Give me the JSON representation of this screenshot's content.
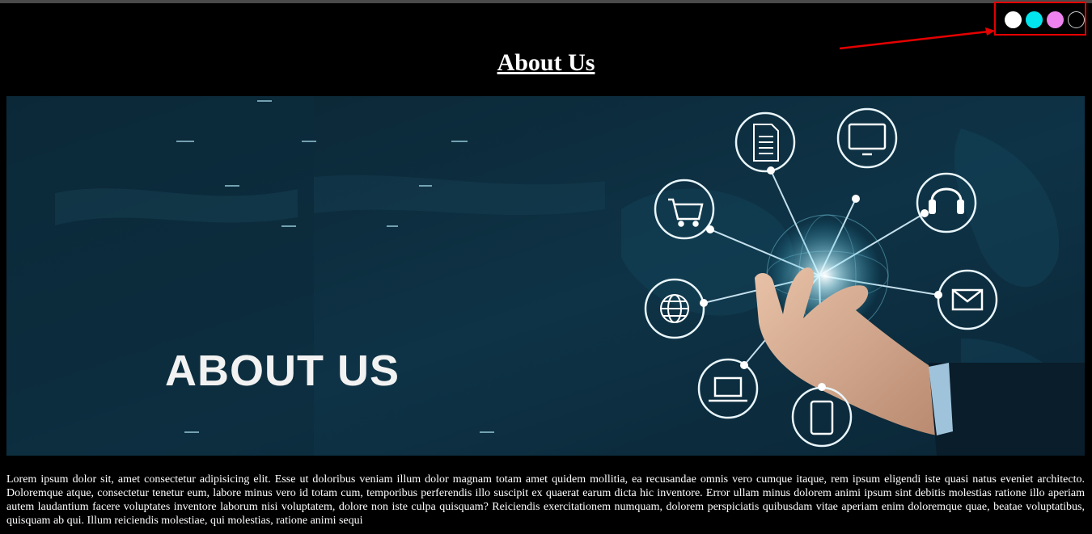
{
  "header": {
    "title": "About Us"
  },
  "theme_picker": {
    "swatches": [
      {
        "name": "white",
        "color": "#ffffff"
      },
      {
        "name": "cyan",
        "color": "#00e5ee"
      },
      {
        "name": "violet",
        "color": "#ee82ee"
      },
      {
        "name": "black",
        "color": "#000000"
      }
    ],
    "highlight_color": "#e60000"
  },
  "hero": {
    "overlay_text": "ABOUT US",
    "icons": [
      "document-icon",
      "monitor-icon",
      "headset-icon",
      "envelope-icon",
      "tablet-icon",
      "laptop-icon",
      "globe-icon",
      "shopping-cart-icon"
    ]
  },
  "content": {
    "paragraph": "Lorem ipsum dolor sit, amet consectetur adipisicing elit. Esse ut doloribus veniam illum dolor magnam totam amet quidem mollitia, ea recusandae omnis vero cumque itaque, rem ipsum eligendi iste quasi natus eveniet architecto. Doloremque atque, consectetur tenetur eum, labore minus vero id totam cum, temporibus perferendis illo suscipit ex quaerat earum dicta hic inventore. Error ullam minus dolorem animi ipsum sint debitis molestias ratione illo aperiam autem laudantium facere voluptates inventore laborum nisi voluptatem, dolore non iste culpa quisquam? Reiciendis exercitationem numquam, dolorem perspiciatis quibusdam vitae aperiam enim doloremque quae, beatae voluptatibus, quisquam ab qui. Illum reiciendis molestiae, qui molestias, ratione animi sequi"
  }
}
